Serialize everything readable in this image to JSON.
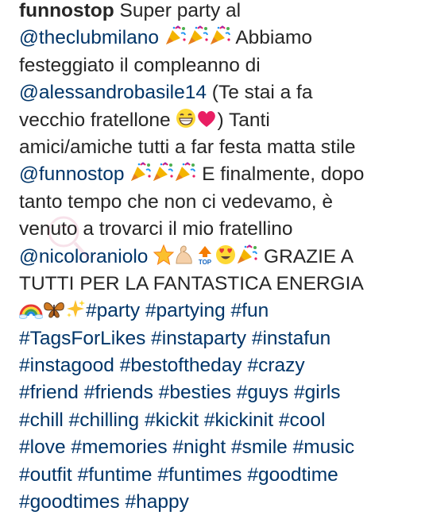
{
  "post": {
    "username": "funnostop",
    "lines": [
      {
        "segments": [
          {
            "type": "user",
            "text": "funnostop"
          },
          {
            "type": "text",
            "text": " Super party al"
          }
        ]
      },
      {
        "segments": [
          {
            "type": "mention",
            "text": "@theclubmilano"
          },
          {
            "type": "text",
            "text": " "
          },
          {
            "type": "emoji",
            "icon": "party-popper-icon"
          },
          {
            "type": "emoji",
            "icon": "party-popper-icon"
          },
          {
            "type": "emoji",
            "icon": "party-popper-icon"
          },
          {
            "type": "text",
            "text": " Abbiamo"
          }
        ]
      },
      {
        "segments": [
          {
            "type": "text",
            "text": "festeggiato il compleanno di"
          }
        ]
      },
      {
        "segments": [
          {
            "type": "mention",
            "text": "@alessandrobasile14"
          },
          {
            "type": "text",
            "text": " (Te stai a fa"
          }
        ]
      },
      {
        "segments": [
          {
            "type": "text",
            "text": "vecchio fratellone "
          },
          {
            "type": "emoji",
            "icon": "grinning-face-icon"
          },
          {
            "type": "emoji",
            "icon": "heart-icon"
          },
          {
            "type": "text",
            "text": ") Tanti"
          }
        ]
      },
      {
        "segments": [
          {
            "type": "text",
            "text": "amici/amiche tutti a far festa matta stile"
          }
        ]
      },
      {
        "segments": [
          {
            "type": "mention",
            "text": "@funnostop"
          },
          {
            "type": "text",
            "text": " "
          },
          {
            "type": "emoji",
            "icon": "party-popper-icon"
          },
          {
            "type": "emoji",
            "icon": "party-popper-icon"
          },
          {
            "type": "emoji",
            "icon": "party-popper-icon"
          },
          {
            "type": "text",
            "text": " E finalmente, dopo"
          }
        ]
      },
      {
        "segments": [
          {
            "type": "text",
            "text": "tanto tempo che non ci vedevamo, è"
          }
        ]
      },
      {
        "segments": [
          {
            "type": "text",
            "text": "venuto a trovarci il mio fratellino"
          }
        ]
      },
      {
        "segments": [
          {
            "type": "mention",
            "text": "@nicoloraniolo"
          },
          {
            "type": "text",
            "text": " "
          },
          {
            "type": "emoji",
            "icon": "star-icon"
          },
          {
            "type": "emoji",
            "icon": "flexed-biceps-icon"
          },
          {
            "type": "emoji",
            "icon": "top-arrow-icon"
          },
          {
            "type": "emoji",
            "icon": "heart-eyes-icon"
          },
          {
            "type": "emoji",
            "icon": "party-popper-icon"
          },
          {
            "type": "text",
            "text": " GRAZIE A"
          }
        ]
      },
      {
        "segments": [
          {
            "type": "text",
            "text": "TUTTI PER LA FANTASTICA ENERGIA"
          }
        ]
      },
      {
        "segments": [
          {
            "type": "emoji",
            "icon": "rainbow-icon"
          },
          {
            "type": "emoji",
            "icon": "butterfly-icon"
          },
          {
            "type": "emoji",
            "icon": "sparkle-icon"
          },
          {
            "type": "tag",
            "text": "#party"
          },
          {
            "type": "text",
            "text": " "
          },
          {
            "type": "tag",
            "text": "#partying"
          },
          {
            "type": "text",
            "text": " "
          },
          {
            "type": "tag",
            "text": "#fun"
          }
        ]
      },
      {
        "segments": [
          {
            "type": "tag",
            "text": "#TagsForLikes"
          },
          {
            "type": "text",
            "text": " "
          },
          {
            "type": "tag",
            "text": "#instaparty"
          },
          {
            "type": "text",
            "text": " "
          },
          {
            "type": "tag",
            "text": "#instafun"
          }
        ]
      },
      {
        "segments": [
          {
            "type": "tag",
            "text": "#instagood"
          },
          {
            "type": "text",
            "text": " "
          },
          {
            "type": "tag",
            "text": "#bestoftheday"
          },
          {
            "type": "text",
            "text": " "
          },
          {
            "type": "tag",
            "text": "#crazy"
          }
        ]
      },
      {
        "segments": [
          {
            "type": "tag",
            "text": "#friend"
          },
          {
            "type": "text",
            "text": " "
          },
          {
            "type": "tag",
            "text": "#friends"
          },
          {
            "type": "text",
            "text": " "
          },
          {
            "type": "tag",
            "text": "#besties"
          },
          {
            "type": "text",
            "text": " "
          },
          {
            "type": "tag",
            "text": "#guys"
          },
          {
            "type": "text",
            "text": " "
          },
          {
            "type": "tag",
            "text": "#girls"
          }
        ]
      },
      {
        "segments": [
          {
            "type": "tag",
            "text": "#chill"
          },
          {
            "type": "text",
            "text": " "
          },
          {
            "type": "tag",
            "text": "#chilling"
          },
          {
            "type": "text",
            "text": " "
          },
          {
            "type": "tag",
            "text": "#kickit"
          },
          {
            "type": "text",
            "text": " "
          },
          {
            "type": "tag",
            "text": "#kickinit"
          },
          {
            "type": "text",
            "text": " "
          },
          {
            "type": "tag",
            "text": "#cool"
          }
        ]
      },
      {
        "segments": [
          {
            "type": "tag",
            "text": "#love"
          },
          {
            "type": "text",
            "text": " "
          },
          {
            "type": "tag",
            "text": "#memories"
          },
          {
            "type": "text",
            "text": " "
          },
          {
            "type": "tag",
            "text": "#night"
          },
          {
            "type": "text",
            "text": " "
          },
          {
            "type": "tag",
            "text": "#smile"
          },
          {
            "type": "text",
            "text": " "
          },
          {
            "type": "tag",
            "text": "#music"
          }
        ]
      },
      {
        "segments": [
          {
            "type": "tag",
            "text": "#outfit"
          },
          {
            "type": "text",
            "text": " "
          },
          {
            "type": "tag",
            "text": "#funtime"
          },
          {
            "type": "text",
            "text": " "
          },
          {
            "type": "tag",
            "text": "#funtimes"
          },
          {
            "type": "text",
            "text": " "
          },
          {
            "type": "tag",
            "text": "#goodtime"
          }
        ]
      },
      {
        "segments": [
          {
            "type": "tag",
            "text": "#goodtimes"
          },
          {
            "type": "text",
            "text": " "
          },
          {
            "type": "tag",
            "text": "#happy"
          }
        ]
      }
    ]
  },
  "colors": {
    "text": "#262626",
    "link": "#003569",
    "background": "#ffffff"
  }
}
